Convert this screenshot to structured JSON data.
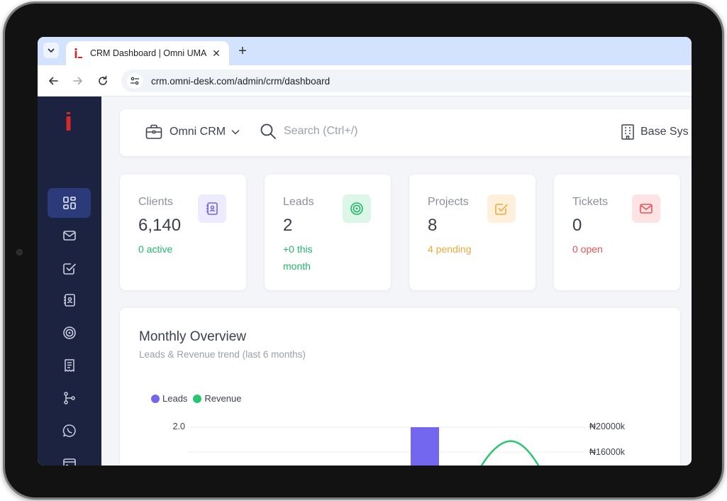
{
  "browser": {
    "tab_title": "CRM Dashboard | Omni UMA",
    "url": "crm.omni-desk.com/admin/crm/dashboard",
    "new_tab_label": "+",
    "close_label": "✕"
  },
  "topbar": {
    "app_switcher_label": "Omni CRM",
    "search_placeholder": "Search (Ctrl+/)",
    "company_label": "Base Sys"
  },
  "sidebar": {
    "items": [
      {
        "icon": "dashboard-icon",
        "active": true
      },
      {
        "icon": "mail-icon",
        "active": false
      },
      {
        "icon": "checkbox-icon",
        "active": false
      },
      {
        "icon": "contacts-icon",
        "active": false
      },
      {
        "icon": "target-icon",
        "active": false
      },
      {
        "icon": "receipt-icon",
        "active": false
      },
      {
        "icon": "pipeline-icon",
        "active": false
      },
      {
        "icon": "whatsapp-icon",
        "active": false
      },
      {
        "icon": "card-icon",
        "active": false
      },
      {
        "icon": "bar-chart-icon",
        "active": false
      }
    ]
  },
  "stats": [
    {
      "label": "Clients",
      "value": "6,140",
      "sub": "0 active",
      "sub_color": "#22b86a",
      "icon": "contacts-icon",
      "icon_bg": "#ecebff",
      "icon_color": "#7264e6"
    },
    {
      "label": "Leads",
      "value": "2",
      "sub": "+0 this month",
      "sub_color": "#22b86a",
      "icon": "target-icon",
      "icon_bg": "#dcf6e7",
      "icon_color": "#22b86a"
    },
    {
      "label": "Projects",
      "value": "8",
      "sub": "4 pending",
      "sub_color": "#f2a93b",
      "icon": "checkbox-icon",
      "icon_bg": "#fff0dc",
      "icon_color": "#f2a93b"
    },
    {
      "label": "Tickets",
      "value": "0",
      "sub": "0 open",
      "sub_color": "#ea5455",
      "icon": "mail-icon",
      "icon_bg": "#fde3e3",
      "icon_color": "#ea5455"
    }
  ],
  "overview": {
    "title": "Monthly Overview",
    "subtitle": "Leads & Revenue trend (last 6 months)"
  },
  "chart_data": {
    "type": "bar",
    "title": "Monthly Overview",
    "subtitle": "Leads & Revenue trend (last 6 months)",
    "series": [
      {
        "name": "Leads",
        "type": "bar",
        "color": "#7367f0",
        "axis": "left"
      },
      {
        "name": "Revenue",
        "type": "line",
        "color": "#28c76f",
        "axis": "right"
      }
    ],
    "left_axis_ticks": [
      "2.0"
    ],
    "right_axis_ticks": [
      "₦20000k",
      "₦16000k"
    ],
    "visible_bar": {
      "series": "Leads",
      "value": 2
    },
    "legend_position": "top-left"
  }
}
